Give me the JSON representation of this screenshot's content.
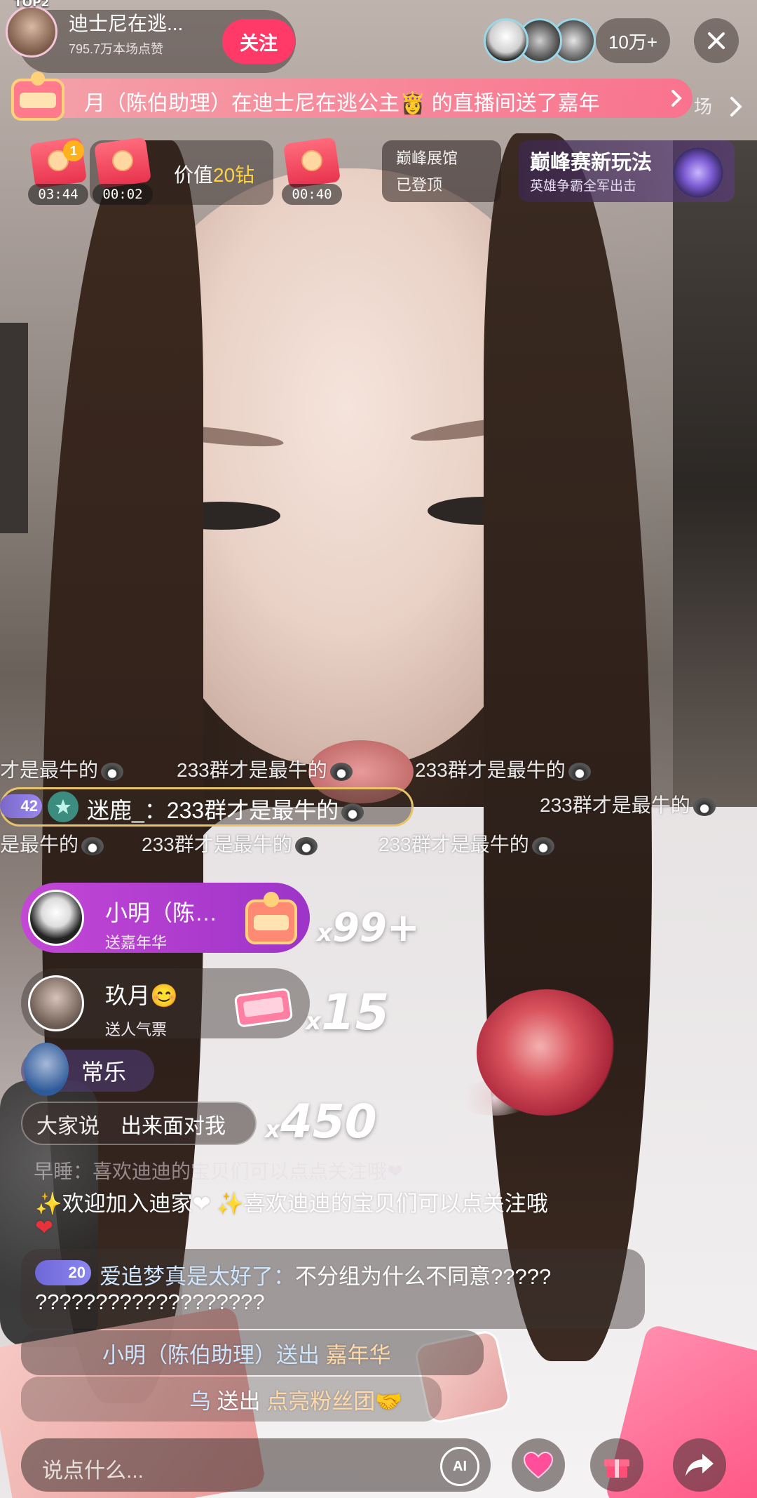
{
  "host": {
    "rank_badge": "TOP2",
    "name": "迪士尼在逃...",
    "likes": "795.7万本场点赞",
    "follow_label": "关注"
  },
  "viewers": {
    "count": "10万+"
  },
  "gift_banner": {
    "text": "月（陈伯助理）在迪士尼在逃公主👸 的直播间送了嘉年",
    "tail": "场"
  },
  "red_packets": [
    {
      "timer": "03:44",
      "badge": "1"
    },
    {
      "timer": "00:02"
    },
    {
      "timer": "00:40"
    }
  ],
  "value_chip": {
    "prefix": "价值",
    "amount": "20钻"
  },
  "pinnacle": {
    "title": "巅峰展馆",
    "subtitle": "已登顶"
  },
  "peak_event": {
    "title": "巅峰赛新玩法",
    "subtitle": "英雄争霸全军出击"
  },
  "danmaku": {
    "row1": [
      "才是最牛的",
      "233群才是最牛的",
      "233群才是最牛的"
    ],
    "row2": [
      "233群才是最牛的"
    ],
    "row3": [
      "是最牛的",
      "233群才是最牛的",
      "233群才是最牛的"
    ],
    "highlight": {
      "level": "42",
      "text": "迷鹿_：233群才是最牛的"
    }
  },
  "gift_toasts": [
    {
      "name": "小明（陈…",
      "action": "送嘉年华",
      "combo": "99+"
    },
    {
      "name": "玖月😊",
      "action": "送人气票",
      "combo": "15"
    }
  ],
  "user_chip": {
    "name": "常乐"
  },
  "everyone_says": {
    "label": "大家说",
    "text": "出来面对我",
    "combo": "450"
  },
  "chat": {
    "faded": "早睡：喜欢迪迪的宝贝们可以点点关注哦❤",
    "welcome_line1": "✨欢迎加入迪家❤ ✨喜欢迪迪的宝贝们可以点关注哦",
    "welcome_line2": "❤",
    "msg_level": "20",
    "msg_user": "爱追梦真是太好了：",
    "msg_text": "不分组为什么不同意?????",
    "msg_text2": "???????????????????",
    "gift_line_user": "小明（陈伯助理）送出",
    "gift_line_gift": "嘉年华",
    "fan_line_user": "乌",
    "fan_line_action": "送出",
    "fan_line_gift": "点亮粉丝团🤝"
  },
  "input": {
    "placeholder": "说点什么...",
    "ai_label": "AI"
  },
  "colors": {
    "follow": "#ff3a69",
    "accent_gold": "#ffd23f",
    "gift_toast": "#c447d6"
  }
}
